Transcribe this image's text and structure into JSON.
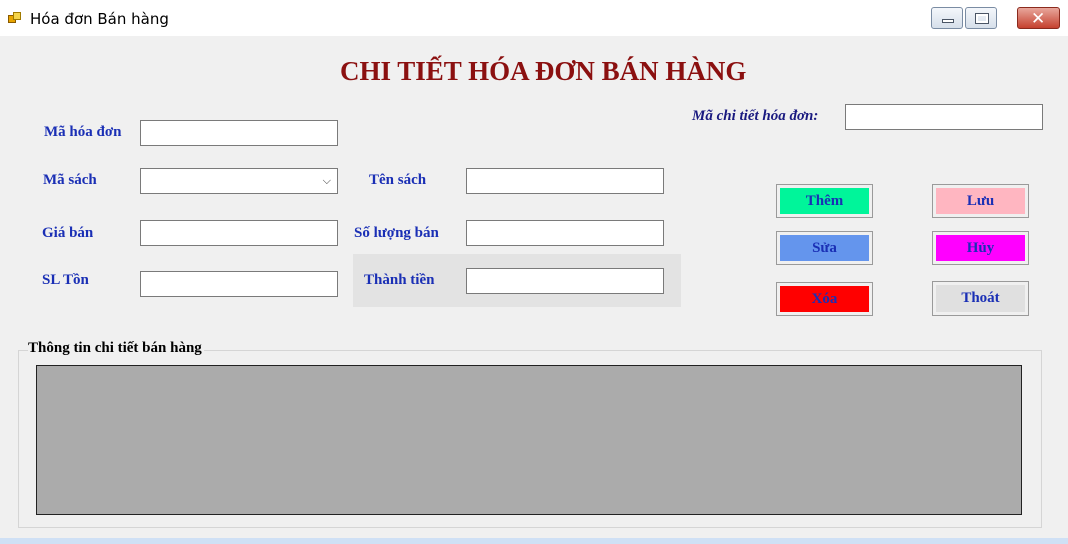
{
  "window": {
    "title": "Hóa đơn Bán hàng",
    "close_glyph": "✕"
  },
  "form": {
    "heading": "CHI TIẾT HÓA ĐƠN BÁN HÀNG",
    "labels": {
      "ma_chi_tiet": "Mã chi tiết hóa đơn:",
      "ma_hoa_don": "Mã hóa đơn",
      "ma_sach": "Mã sách",
      "ten_sach": "Tên sách",
      "gia_ban": "Giá bán",
      "so_luong_ban": "Số lượng bán",
      "sl_ton": "SL Tồn",
      "thanh_tien": "Thành tiền"
    },
    "values": {
      "ma_chi_tiet": "",
      "ma_hoa_don": "",
      "ma_sach": "",
      "ten_sach": "",
      "gia_ban": "",
      "so_luong_ban": "",
      "sl_ton": "",
      "thanh_tien": ""
    }
  },
  "buttons": {
    "them": "Thêm",
    "luu": "Lưu",
    "sua": "Sửa",
    "huy": "Hủy",
    "xoa": "Xóa",
    "thoat": "Thoát"
  },
  "colors": {
    "them": "#00f59a",
    "luu": "#ffb6c1",
    "sua": "#6495ed",
    "huy": "#ff00ff",
    "xoa": "#ff0000",
    "thoat": "#e0e0e0",
    "heading": "#8b1010",
    "label": "#1a2fb5"
  },
  "grid_section": {
    "title": "Thông tin chi tiết bán hàng"
  }
}
